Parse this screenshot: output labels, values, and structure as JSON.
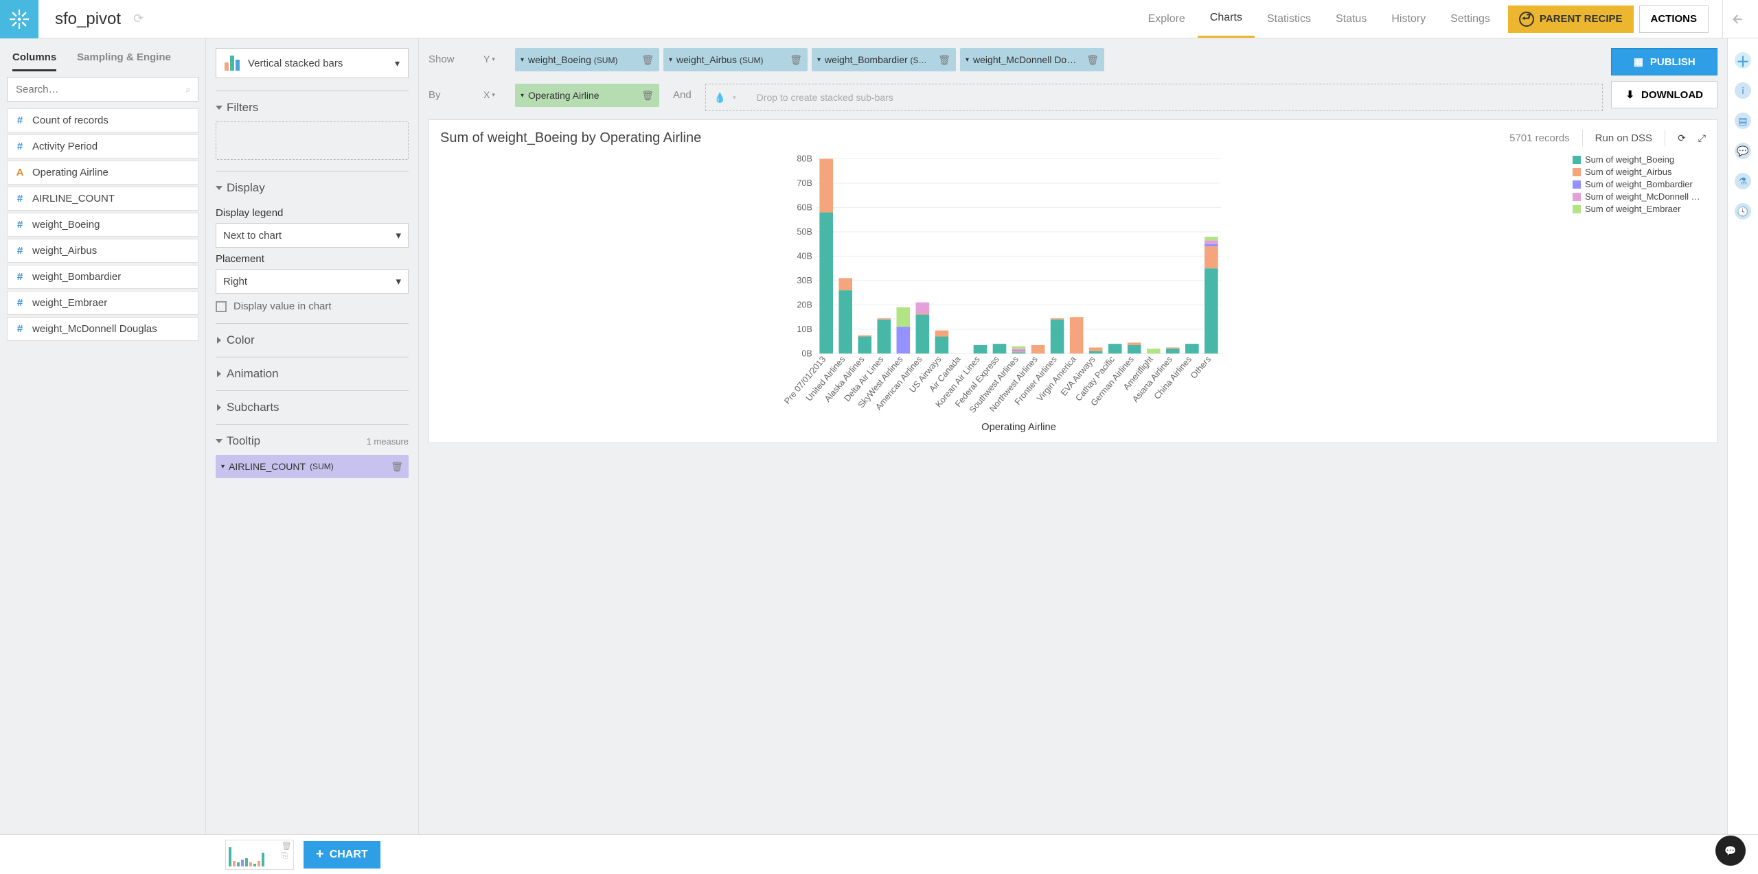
{
  "header": {
    "title": "sfo_pivot",
    "tabs": [
      "Explore",
      "Charts",
      "Statistics",
      "Status",
      "History",
      "Settings"
    ],
    "active_tab": "Charts",
    "parent_recipe": "PARENT RECIPE",
    "actions": "ACTIONS"
  },
  "sidebar": {
    "tabs": [
      "Columns",
      "Sampling & Engine"
    ],
    "active": "Columns",
    "search_placeholder": "Search…",
    "columns": [
      {
        "type": "#",
        "name": "Count of records"
      },
      {
        "type": "#",
        "name": "Activity Period"
      },
      {
        "type": "A",
        "name": "Operating Airline"
      },
      {
        "type": "#",
        "name": "AIRLINE_COUNT"
      },
      {
        "type": "#",
        "name": "weight_Boeing"
      },
      {
        "type": "#",
        "name": "weight_Airbus"
      },
      {
        "type": "#",
        "name": "weight_Bombardier"
      },
      {
        "type": "#",
        "name": "weight_Embraer"
      },
      {
        "type": "#",
        "name": "weight_McDonnell Douglas"
      }
    ]
  },
  "config": {
    "chart_type": "Vertical stacked bars",
    "filters": {
      "title": "Filters"
    },
    "display": {
      "title": "Display",
      "legend_label": "Display legend",
      "legend_value": "Next to chart",
      "placement_label": "Placement",
      "placement_value": "Right",
      "display_value_label": "Display value in chart"
    },
    "color": {
      "title": "Color"
    },
    "animation": {
      "title": "Animation"
    },
    "subcharts": {
      "title": "Subcharts"
    },
    "tooltip": {
      "title": "Tooltip",
      "count": "1 measure",
      "pill": {
        "name": "AIRLINE_COUNT",
        "agg": "(SUM)"
      }
    }
  },
  "shelf": {
    "show": "Show",
    "by": "By",
    "and": "And",
    "y_pills": [
      {
        "name": "weight_Boeing",
        "agg": "(SUM)"
      },
      {
        "name": "weight_Airbus",
        "agg": "(SUM)"
      },
      {
        "name": "weight_Bombardier",
        "agg": "(S…"
      },
      {
        "name": "weight_McDonnell Do…",
        "agg": ""
      }
    ],
    "x_pill": {
      "name": "Operating Airline"
    },
    "drop_hint": "Drop to create stacked sub-bars"
  },
  "actions": {
    "publish": "PUBLISH",
    "download": "DOWNLOAD"
  },
  "chart": {
    "title": "Sum of weight_Boeing by Operating Airline",
    "records": "5701 records",
    "run": "Run on DSS",
    "xlabel": "Operating Airline",
    "legend": [
      {
        "color": "#47b8a8",
        "label": "Sum of weight_Boeing"
      },
      {
        "color": "#f5a57c",
        "label": "Sum of weight_Airbus"
      },
      {
        "color": "#9592ff",
        "label": "Sum of weight_Bombardier"
      },
      {
        "color": "#e4a0d8",
        "label": "Sum of weight_McDonnell …"
      },
      {
        "color": "#b2e384",
        "label": "Sum of weight_Embraer"
      }
    ]
  },
  "footer": {
    "chart_btn": "CHART"
  },
  "chart_data": {
    "type": "bar",
    "stacked": true,
    "title": "Sum of weight_Boeing by Operating Airline",
    "xlabel": "Operating Airline",
    "ylabel": "",
    "ylim": [
      0,
      80
    ],
    "y_unit": "B",
    "categories": [
      "Pre 07/01/2013",
      "United Airlines",
      "Alaska Airlines",
      "Delta Air Lines",
      "SkyWest Airlines",
      "American Airlines",
      "US Airways",
      "Air Canada",
      "Korean Air Lines",
      "Federal Express",
      "Southwest Airlines",
      "Northwest Airlines",
      "Frontier Airlines",
      "Virgin America",
      "EVA Airways",
      "Cathay Pacific",
      "German Airlines",
      "Ameriflight",
      "Asiana Airlines",
      "China Airlines",
      "Others"
    ],
    "series": [
      {
        "name": "Sum of weight_Boeing",
        "color": "#47b8a8",
        "values": [
          58,
          26,
          7,
          14,
          0,
          16,
          7,
          0,
          3.5,
          4,
          0.5,
          0,
          14,
          0,
          1,
          4,
          3.5,
          0,
          2,
          4,
          35
        ]
      },
      {
        "name": "Sum of weight_Airbus",
        "color": "#f5a57c",
        "values": [
          22,
          5,
          0.5,
          0.5,
          0,
          0.5,
          2.5,
          0,
          0,
          0,
          0.5,
          3.5,
          0.5,
          15,
          1.5,
          0,
          1,
          0,
          0.5,
          0,
          9
        ]
      },
      {
        "name": "Sum of weight_Bombardier",
        "color": "#9592ff",
        "values": [
          0,
          0,
          0,
          0,
          11,
          0,
          0,
          0,
          0,
          0,
          0.5,
          0,
          0,
          0,
          0,
          0,
          0,
          0,
          0,
          0,
          1
        ]
      },
      {
        "name": "Sum of weight_McDonnell Douglas",
        "color": "#e4a0d8",
        "values": [
          0,
          0,
          0,
          0,
          0,
          4.5,
          0,
          0,
          0,
          0,
          0.5,
          0,
          0,
          0,
          0,
          0,
          0,
          0,
          0,
          0,
          1.5
        ]
      },
      {
        "name": "Sum of weight_Embraer",
        "color": "#b2e384",
        "values": [
          0,
          0,
          0,
          0,
          8,
          0,
          0,
          0,
          0,
          0,
          1,
          0,
          0,
          0,
          0,
          0,
          0,
          2,
          0,
          0,
          1.5
        ]
      }
    ]
  }
}
